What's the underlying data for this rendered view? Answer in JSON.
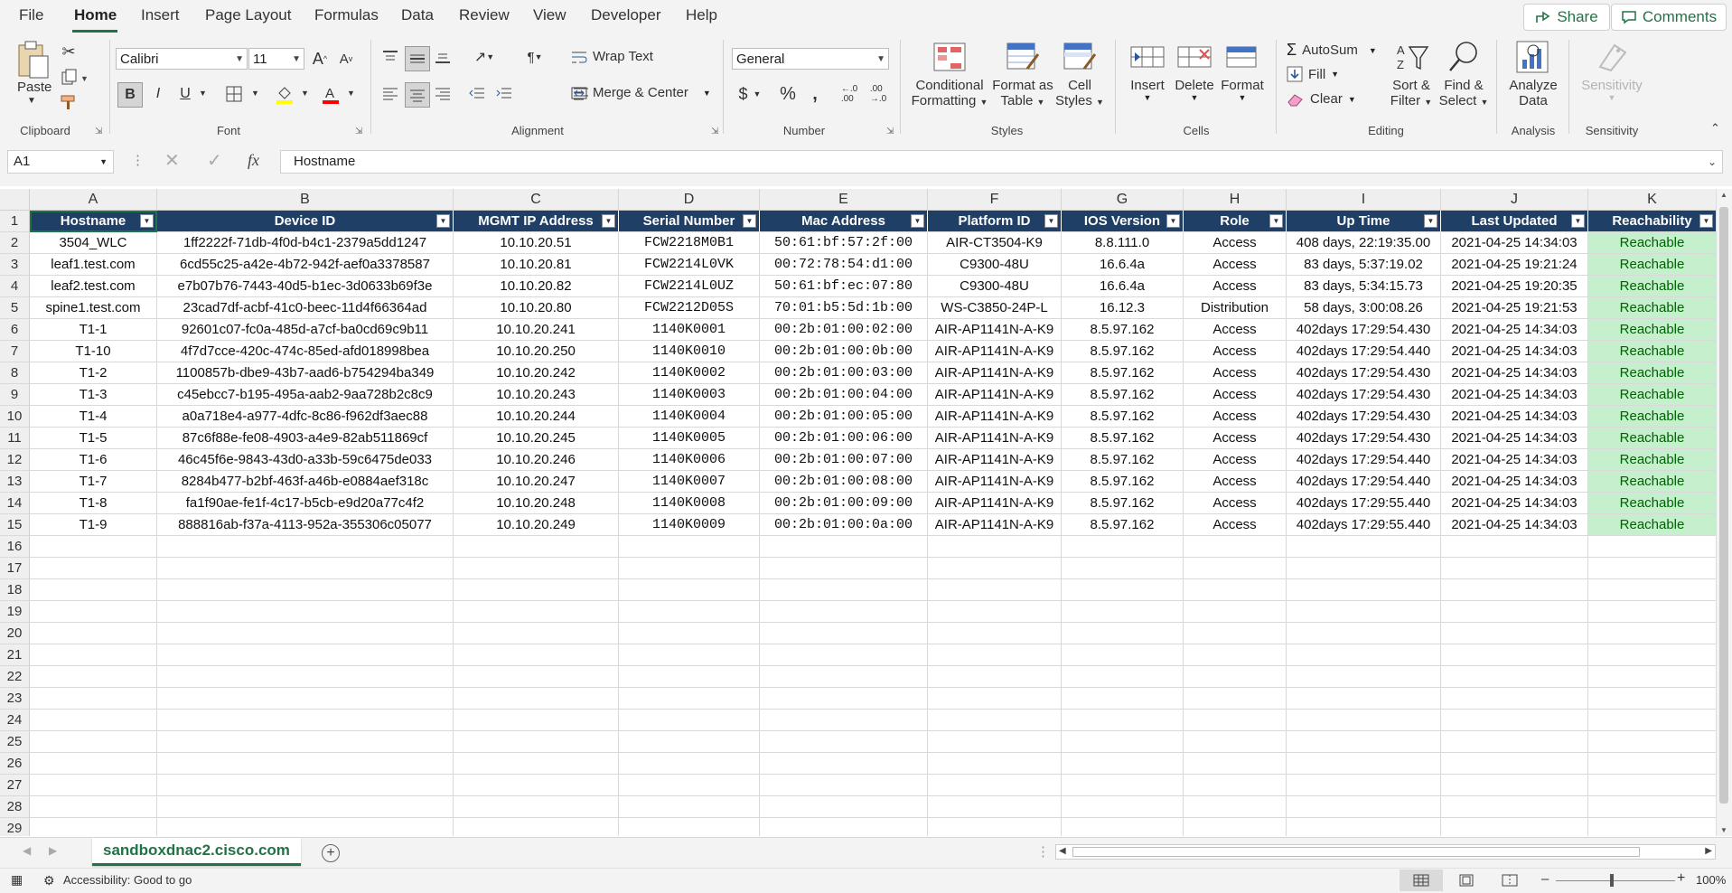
{
  "menu": {
    "tabs": [
      "File",
      "Home",
      "Insert",
      "Page Layout",
      "Formulas",
      "Data",
      "Review",
      "View",
      "Developer",
      "Help"
    ],
    "active": "Home",
    "share_label": "Share",
    "comments_label": "Comments"
  },
  "ribbon": {
    "clipboard": {
      "paste": "Paste",
      "label": "Clipboard"
    },
    "font": {
      "name": "Calibri",
      "size": "11",
      "label": "Font"
    },
    "alignment": {
      "wrap_text": "Wrap Text",
      "merge_center": "Merge & Center",
      "label": "Alignment"
    },
    "number": {
      "format": "General",
      "label": "Number"
    },
    "styles": {
      "conditional_1": "Conditional",
      "conditional_2": "Formatting",
      "format_table_1": "Format as",
      "format_table_2": "Table",
      "cell_styles_1": "Cell",
      "cell_styles_2": "Styles",
      "label": "Styles"
    },
    "cells": {
      "insert": "Insert",
      "delete": "Delete",
      "format": "Format",
      "label": "Cells"
    },
    "editing": {
      "autosum": "AutoSum",
      "fill": "Fill",
      "clear": "Clear",
      "sort_1": "Sort &",
      "sort_2": "Filter",
      "find_1": "Find &",
      "find_2": "Select",
      "label": "Editing"
    },
    "analysis": {
      "analyze_1": "Analyze",
      "analyze_2": "Data",
      "label": "Analysis"
    },
    "sensitivity": {
      "button": "Sensitivity",
      "label": "Sensitivity"
    }
  },
  "formula_bar": {
    "name_box": "A1",
    "fx": "fx",
    "content": "Hostname"
  },
  "grid": {
    "columns": [
      "A",
      "B",
      "C",
      "D",
      "E",
      "F",
      "G",
      "H",
      "I",
      "J",
      "K"
    ],
    "headers": [
      "Hostname",
      "Device ID",
      "MGMT IP Address",
      "Serial Number",
      "Mac Address",
      "Platform ID",
      "IOS Version",
      "Role",
      "Up Time",
      "Last Updated",
      "Reachability"
    ],
    "rows": [
      [
        "3504_WLC",
        "1ff2222f-71db-4f0d-b4c1-2379a5dd1247",
        "10.10.20.51",
        "FCW2218M0B1",
        "50:61:bf:57:2f:00",
        "AIR-CT3504-K9",
        "8.8.111.0",
        "Access",
        "408 days, 22:19:35.00",
        "2021-04-25 14:34:03",
        "Reachable"
      ],
      [
        "leaf1.test.com",
        "6cd55c25-a42e-4b72-942f-aef0a3378587",
        "10.10.20.81",
        "FCW2214L0VK",
        "00:72:78:54:d1:00",
        "C9300-48U",
        "16.6.4a",
        "Access",
        "83 days, 5:37:19.02",
        "2021-04-25 19:21:24",
        "Reachable"
      ],
      [
        "leaf2.test.com",
        "e7b07b76-7443-40d5-b1ec-3d0633b69f3e",
        "10.10.20.82",
        "FCW2214L0UZ",
        "50:61:bf:ec:07:80",
        "C9300-48U",
        "16.6.4a",
        "Access",
        "83 days, 5:34:15.73",
        "2021-04-25 19:20:35",
        "Reachable"
      ],
      [
        "spine1.test.com",
        "23cad7df-acbf-41c0-beec-11d4f66364ad",
        "10.10.20.80",
        "FCW2212D05S",
        "70:01:b5:5d:1b:00",
        "WS-C3850-24P-L",
        "16.12.3",
        "Distribution",
        "58 days, 3:00:08.26",
        "2021-04-25 19:21:53",
        "Reachable"
      ],
      [
        "T1-1",
        "92601c07-fc0a-485d-a7cf-ba0cd69c9b11",
        "10.10.20.241",
        "1140K0001",
        "00:2b:01:00:02:00",
        "AIR-AP1141N-A-K9",
        "8.5.97.162",
        "Access",
        "402days 17:29:54.430",
        "2021-04-25 14:34:03",
        "Reachable"
      ],
      [
        "T1-10",
        "4f7d7cce-420c-474c-85ed-afd018998bea",
        "10.10.20.250",
        "1140K0010",
        "00:2b:01:00:0b:00",
        "AIR-AP1141N-A-K9",
        "8.5.97.162",
        "Access",
        "402days 17:29:54.440",
        "2021-04-25 14:34:03",
        "Reachable"
      ],
      [
        "T1-2",
        "1100857b-dbe9-43b7-aad6-b754294ba349",
        "10.10.20.242",
        "1140K0002",
        "00:2b:01:00:03:00",
        "AIR-AP1141N-A-K9",
        "8.5.97.162",
        "Access",
        "402days 17:29:54.430",
        "2021-04-25 14:34:03",
        "Reachable"
      ],
      [
        "T1-3",
        "c45ebcc7-b195-495a-aab2-9aa728b2c8c9",
        "10.10.20.243",
        "1140K0003",
        "00:2b:01:00:04:00",
        "AIR-AP1141N-A-K9",
        "8.5.97.162",
        "Access",
        "402days 17:29:54.430",
        "2021-04-25 14:34:03",
        "Reachable"
      ],
      [
        "T1-4",
        "a0a718e4-a977-4dfc-8c86-f962df3aec88",
        "10.10.20.244",
        "1140K0004",
        "00:2b:01:00:05:00",
        "AIR-AP1141N-A-K9",
        "8.5.97.162",
        "Access",
        "402days 17:29:54.430",
        "2021-04-25 14:34:03",
        "Reachable"
      ],
      [
        "T1-5",
        "87c6f88e-fe08-4903-a4e9-82ab511869cf",
        "10.10.20.245",
        "1140K0005",
        "00:2b:01:00:06:00",
        "AIR-AP1141N-A-K9",
        "8.5.97.162",
        "Access",
        "402days 17:29:54.430",
        "2021-04-25 14:34:03",
        "Reachable"
      ],
      [
        "T1-6",
        "46c45f6e-9843-43d0-a33b-59c6475de033",
        "10.10.20.246",
        "1140K0006",
        "00:2b:01:00:07:00",
        "AIR-AP1141N-A-K9",
        "8.5.97.162",
        "Access",
        "402days 17:29:54.440",
        "2021-04-25 14:34:03",
        "Reachable"
      ],
      [
        "T1-7",
        "8284b477-b2bf-463f-a46b-e0884aef318c",
        "10.10.20.247",
        "1140K0007",
        "00:2b:01:00:08:00",
        "AIR-AP1141N-A-K9",
        "8.5.97.162",
        "Access",
        "402days 17:29:54.440",
        "2021-04-25 14:34:03",
        "Reachable"
      ],
      [
        "T1-8",
        "fa1f90ae-fe1f-4c17-b5cb-e9d20a77c4f2",
        "10.10.20.248",
        "1140K0008",
        "00:2b:01:00:09:00",
        "AIR-AP1141N-A-K9",
        "8.5.97.162",
        "Access",
        "402days 17:29:55.440",
        "2021-04-25 14:34:03",
        "Reachable"
      ],
      [
        "T1-9",
        "888816ab-f37a-4113-952a-355306c05077",
        "10.10.20.249",
        "1140K0009",
        "00:2b:01:00:0a:00",
        "AIR-AP1141N-A-K9",
        "8.5.97.162",
        "Access",
        "402days 17:29:55.440",
        "2021-04-25 14:34:03",
        "Reachable"
      ]
    ],
    "row_numbers": [
      "1",
      "2",
      "3",
      "4",
      "5",
      "6",
      "7",
      "8",
      "9",
      "10",
      "11",
      "12",
      "13",
      "14",
      "15",
      "16",
      "17",
      "18",
      "19",
      "20",
      "21",
      "22",
      "23",
      "24",
      "25",
      "26",
      "27",
      "28",
      "29"
    ]
  },
  "sheet": {
    "tab": "sandboxdnac2.cisco.com"
  },
  "status": {
    "accessibility": "Accessibility: Good to go",
    "zoom": "100%"
  },
  "colors": {
    "accent": "#217346",
    "header_bg": "#1f3f66",
    "good_fill": "#c6efce",
    "good_text": "#006100"
  }
}
